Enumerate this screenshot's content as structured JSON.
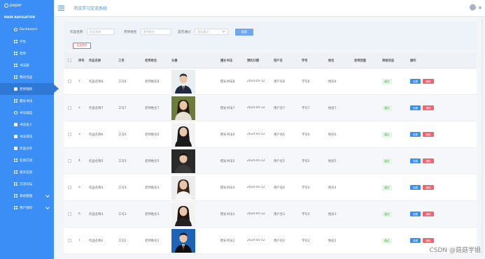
{
  "app": {
    "logo": "paper",
    "title": "书法学习交流系统"
  },
  "sidebar": {
    "section_title": "MAIN NAVIGATION",
    "items": [
      {
        "label": "Dashboard",
        "icon": "circle-icon"
      },
      {
        "label": "学生",
        "icon": "grid-icon"
      },
      {
        "label": "老师",
        "icon": "grid-icon"
      },
      {
        "label": "书法家",
        "icon": "grid-icon"
      },
      {
        "label": "我的作品",
        "icon": "grid-icon"
      },
      {
        "label": "老师我的",
        "icon": "square-icon"
      },
      {
        "label": "擅长书法",
        "icon": "grid-icon"
      },
      {
        "label": "书法类型",
        "icon": "circle-icon"
      },
      {
        "label": "书法名人",
        "icon": "square-icon"
      },
      {
        "label": "书法资讯",
        "icon": "square-icon"
      },
      {
        "label": "作品分享",
        "icon": "square-icon"
      },
      {
        "label": "在线交流",
        "icon": "grid-icon"
      },
      {
        "label": "投诉信息",
        "icon": "grid-icon"
      },
      {
        "label": "交流论坛",
        "icon": "grid-icon"
      },
      {
        "label": "系统管理",
        "icon": "grid-icon"
      },
      {
        "label": "用户资料",
        "icon": "grid-icon"
      }
    ],
    "active_index": 5,
    "expandable": [
      14,
      15
    ]
  },
  "filter": {
    "label1": "作品名称",
    "placeholder1": "作品名称",
    "label2": "老师姓名",
    "placeholder2": "老师姓名",
    "label3": "是否通过",
    "placeholder3": "是否通过",
    "search_label": "搜索",
    "batch_delete_label": "批量删除"
  },
  "table": {
    "headers": [
      "序号",
      "作品名称",
      "工号",
      "老师姓名",
      "头像",
      "擅长书法",
      "预约日期",
      "用户名",
      "学号",
      "姓名",
      "老师回复",
      "审核状态",
      "操作"
    ],
    "rows": [
      {
        "idx": "1",
        "name": "作品名称8",
        "tno": "工号8",
        "tname": "老师姓名8",
        "style": "擅长书法8",
        "date": "2024-05-12",
        "uname": "用户名8",
        "sno": "学号8",
        "sname": "姓名8",
        "reply": "",
        "audit": "通过",
        "photo": "male"
      },
      {
        "idx": "2",
        "name": "作品名称7",
        "tno": "工号7",
        "tname": "老师姓名7",
        "style": "擅长书法7",
        "date": "2024-05-12",
        "uname": "用户名7",
        "sno": "学号7",
        "sname": "姓名7",
        "reply": "",
        "audit": "通过",
        "photo": "female-outdoor"
      },
      {
        "idx": "3",
        "name": "作品名称6",
        "tno": "工号6",
        "tname": "老师姓名6",
        "style": "擅长书法6",
        "date": "2024-05-12",
        "uname": "用户名6",
        "sno": "学号6",
        "sname": "姓名6",
        "reply": "",
        "audit": "通过",
        "photo": "female-light"
      },
      {
        "idx": "4",
        "name": "作品名称5",
        "tno": "工号5",
        "tname": "老师姓名5",
        "style": "擅长书法5",
        "date": "2024-05-12",
        "uname": "用户名5",
        "sno": "学号5",
        "sname": "姓名5",
        "reply": "",
        "audit": "通过",
        "photo": "male-dark"
      },
      {
        "idx": "5",
        "name": "作品名称4",
        "tno": "工号4",
        "tname": "老师姓名4",
        "style": "擅长书法4",
        "date": "2024-05-12",
        "uname": "用户名4",
        "sno": "学号4",
        "sname": "姓名4",
        "reply": "",
        "audit": "通过",
        "photo": "female-white"
      },
      {
        "idx": "6",
        "name": "作品名称3",
        "tno": "工号3",
        "tname": "老师姓名3",
        "style": "擅长书法3",
        "date": "2024-05-12",
        "uname": "用户名3",
        "sno": "学号3",
        "sname": "姓名3",
        "reply": "",
        "audit": "通过",
        "photo": "female-suit"
      },
      {
        "idx": "7",
        "name": "作品名称2",
        "tno": "工号2",
        "tname": "老师姓名2",
        "style": "擅长书法2",
        "date": "2024-05-12",
        "uname": "用户名2",
        "sno": "学号2",
        "sname": "姓名2",
        "reply": "",
        "audit": "通过",
        "photo": "male-blue"
      }
    ],
    "view_label": "查看",
    "delete_label": "删除"
  },
  "watermark": "CSDN @菇菇学姐",
  "colors": {
    "primary": "#3a8ef6",
    "danger": "#f06470",
    "success": "#4caf50"
  }
}
